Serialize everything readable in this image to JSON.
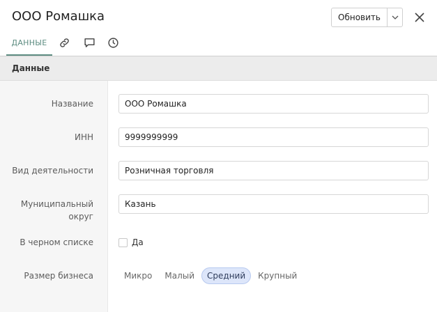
{
  "header": {
    "title": "ООО Ромашка",
    "update_label": "Обновить"
  },
  "tabs": {
    "data_label": "ДАННЫЕ",
    "icons": [
      "link-icon",
      "comment-icon",
      "history-icon"
    ]
  },
  "section": {
    "title": "Данные"
  },
  "form": {
    "name": {
      "label": "Название",
      "value": "ООО Ромашка"
    },
    "inn": {
      "label": "ИНН",
      "value": "9999999999"
    },
    "activity": {
      "label": "Вид деятельности",
      "value": "Розничная торговля"
    },
    "district": {
      "label_line1": "Муниципальный",
      "label_line2": "округ",
      "value": "Казань"
    },
    "blacklist": {
      "label": "В черном списке",
      "option_label": "Да",
      "checked": false
    },
    "business_size": {
      "label": "Размер бизнеса",
      "options": [
        "Микро",
        "Малый",
        "Средний",
        "Крупный"
      ],
      "selected": "Средний"
    }
  },
  "colors": {
    "accent": "#5e8d82",
    "selected_segment_bg": "#dde6fa",
    "section_header_bg": "#ececec"
  }
}
